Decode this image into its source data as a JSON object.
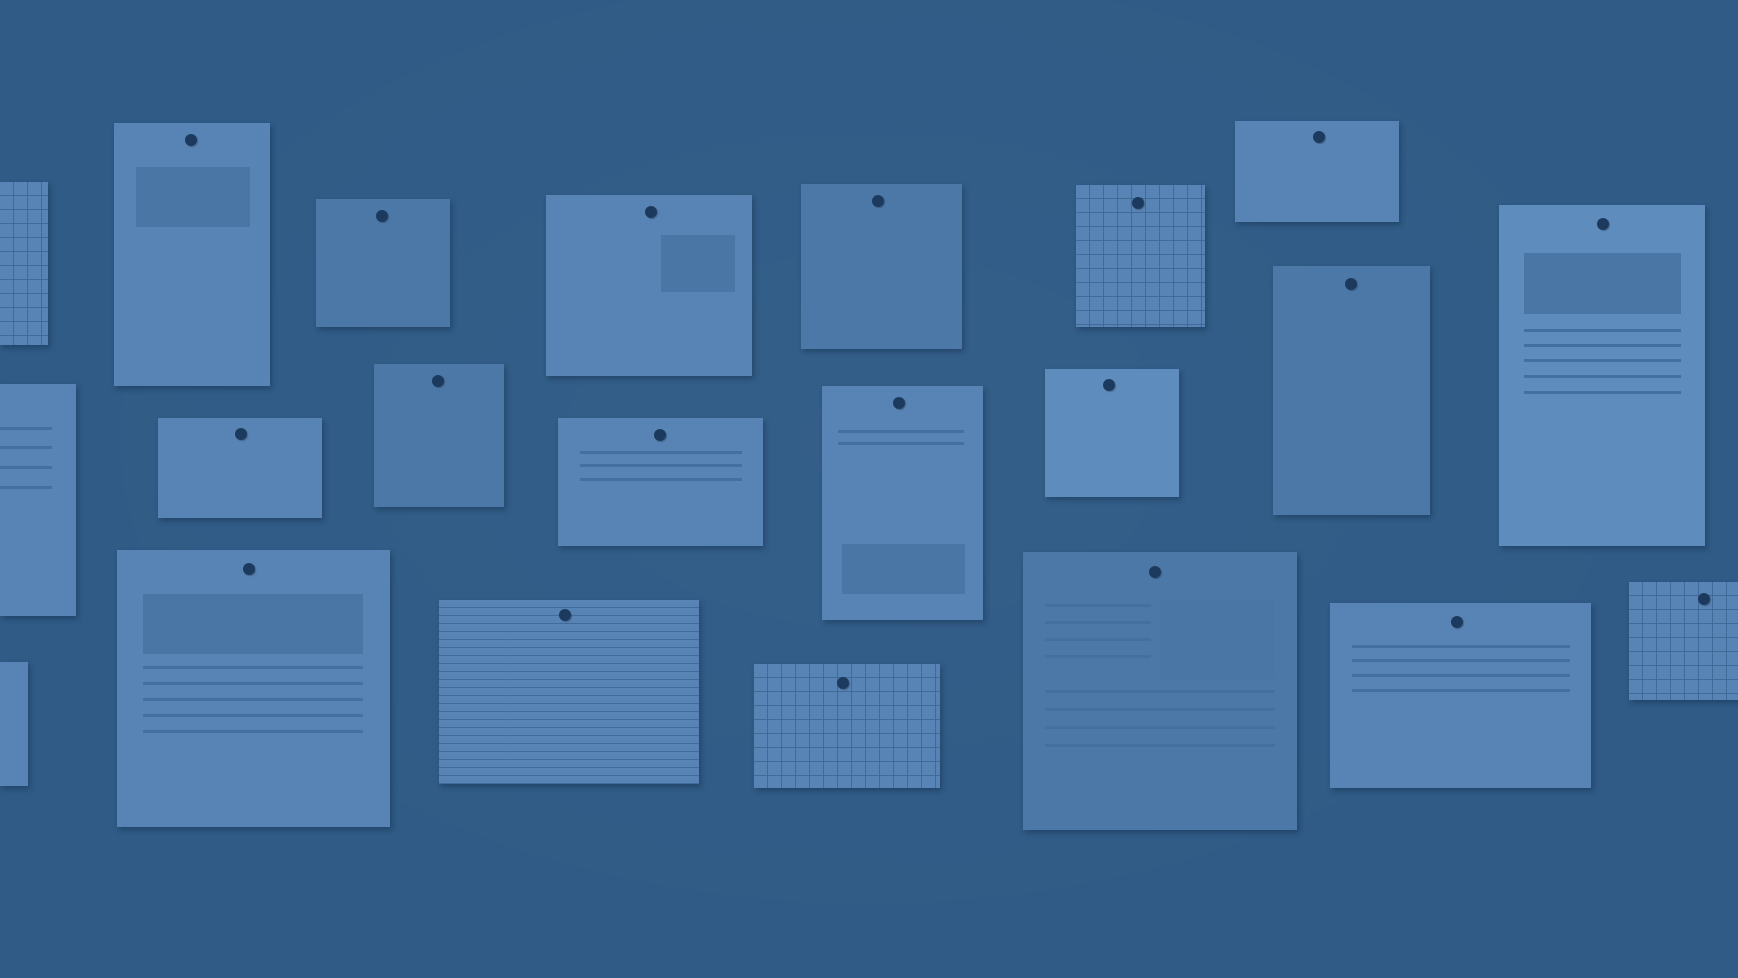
{
  "scene": {
    "background_color": "#2f5b86",
    "note_color": "#5784b4",
    "pin_color": "#1c3a5e",
    "pin_icon": "pushpin-icon"
  }
}
